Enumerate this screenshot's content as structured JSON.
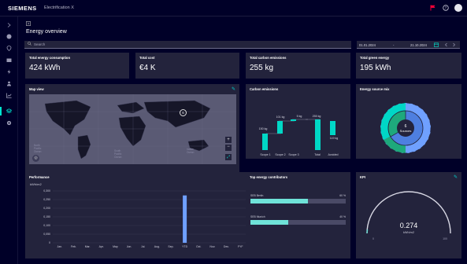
{
  "header": {
    "brand": "SIEMENS",
    "app_title": "Electrification X",
    "icons": [
      "flag-icon",
      "help-icon",
      "user-avatar"
    ]
  },
  "colors": {
    "background": "#000028",
    "card": "#23233c",
    "accent": "#00e5d0",
    "flag": "#ef0137",
    "bar": "#6fa0ff",
    "emission": "#00d7c6",
    "mix_dark": "#1ea97c",
    "mix_blue": "#6fa0ff"
  },
  "nav": {
    "items": [
      "chevron-right-icon",
      "home-icon",
      "location-icon",
      "folder-icon",
      "lightning-icon",
      "person-icon",
      "chart-icon",
      "layers-icon",
      "settings-icon"
    ],
    "active_index": 7
  },
  "page": {
    "collapse_icon": "collapse-icon",
    "title": "Energy overview"
  },
  "search": {
    "placeholder": "Search"
  },
  "date_range": {
    "start": "01.01.2024",
    "separator": "-",
    "end": "21.10.2024"
  },
  "kpis": [
    {
      "title": "Total energy consumption",
      "value": "424 kWh"
    },
    {
      "title": "Total cost",
      "value": "€4 K"
    },
    {
      "title": "Total carbon emissions",
      "value": "255 kg"
    },
    {
      "title": "Total green energy",
      "value": "195 kWh"
    }
  ],
  "map": {
    "title": "Map view",
    "marker_label": "6",
    "labels": [
      "North Pacific Ocean",
      "South Pacific Ocean",
      "Indian Ocean"
    ]
  },
  "carbon": {
    "title": "Carbon emissions",
    "categories": [
      "Scope 1",
      "Scope 2",
      "Scope 3",
      "Total",
      "Avoided"
    ],
    "labels": [
      "150 kg",
      "101 kg",
      "5 kg",
      "255 kg",
      "119 kg"
    ]
  },
  "mix": {
    "title": "Energy source mix",
    "center_value": "6",
    "center_label": "Sources"
  },
  "performance": {
    "title": "Performance",
    "unit": "kWh/m2",
    "chart_data": {
      "type": "bar",
      "categories": [
        "Jan.",
        "Feb.",
        "Mar.",
        "Apr.",
        "May",
        "Jun.",
        "Jul.",
        "Aug.",
        "Sep.",
        "YTD",
        "Oct.",
        "Nov.",
        "Dec.",
        "FYF"
      ],
      "values": [
        0,
        0,
        0,
        0,
        0,
        0,
        0,
        0,
        0,
        0.274,
        0,
        0,
        0,
        0
      ],
      "ylim": [
        0,
        0.3
      ],
      "yticks": [
        "0,300",
        "0,250",
        "0,200",
        "0,150",
        "0,100",
        "0,050",
        "0"
      ]
    }
  },
  "contributors": {
    "title": "Top energy contributors",
    "items": [
      {
        "name": "SEB Berlin",
        "percent": "60 %",
        "fraction": 0.6
      },
      {
        "name": "SEB Munich",
        "percent": "40 %",
        "fraction": 0.4
      }
    ]
  },
  "kpi": {
    "title": "KPI",
    "value": "0.274",
    "unit": "kWh/m2",
    "min": "0",
    "max": "100"
  }
}
